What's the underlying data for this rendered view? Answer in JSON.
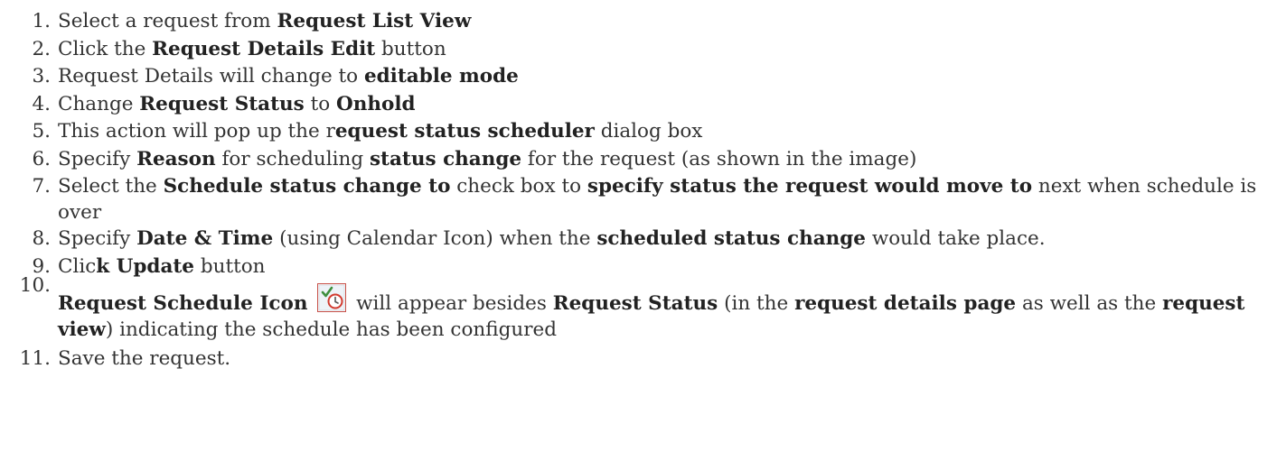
{
  "steps": [
    {
      "n": "1.",
      "parts": [
        "Select a request from ",
        "Request List View"
      ]
    },
    {
      "n": "2.",
      "parts": [
        "Click the ",
        "Request Details Edit",
        " button"
      ]
    },
    {
      "n": "3.",
      "parts": [
        "Request Details will change to ",
        "editable mode"
      ]
    },
    {
      "n": "4.",
      "parts": [
        "Change ",
        "Request Status",
        " to ",
        "Onhold"
      ]
    },
    {
      "n": "5.",
      "parts": [
        "This action will pop up the r",
        "equest status scheduler",
        " dialog box"
      ]
    },
    {
      "n": "6.",
      "parts": [
        "Specify ",
        "Reason",
        " for scheduling ",
        "status change",
        " for the request (as shown in the image)"
      ]
    },
    {
      "n": "7.",
      "parts": [
        "Select the ",
        "Schedule status change to",
        " check box to ",
        "specify status the request would move to",
        " next when schedule is over"
      ]
    },
    {
      "n": "8.",
      "parts": [
        "Specify ",
        "Date & Time",
        " (using Calendar Icon) when the ",
        "scheduled status change",
        " would take place."
      ]
    },
    {
      "n": "9.",
      "parts": [
        "Clic",
        "k Update",
        " button"
      ]
    },
    {
      "n": "10.",
      "parts": [
        "Request Schedule Icon",
        " will appear besides ",
        "Request Status",
        " (in the ",
        "request details page",
        " as well as the ",
        "request view",
        ") indicating the schedule has been configured"
      ]
    },
    {
      "n": "11.",
      "parts": [
        "Save the request."
      ]
    }
  ],
  "icon": {
    "name": "request-schedule-icon",
    "border": "#c8524a",
    "check": "#3f8f3f",
    "clock": "#d23b30"
  }
}
